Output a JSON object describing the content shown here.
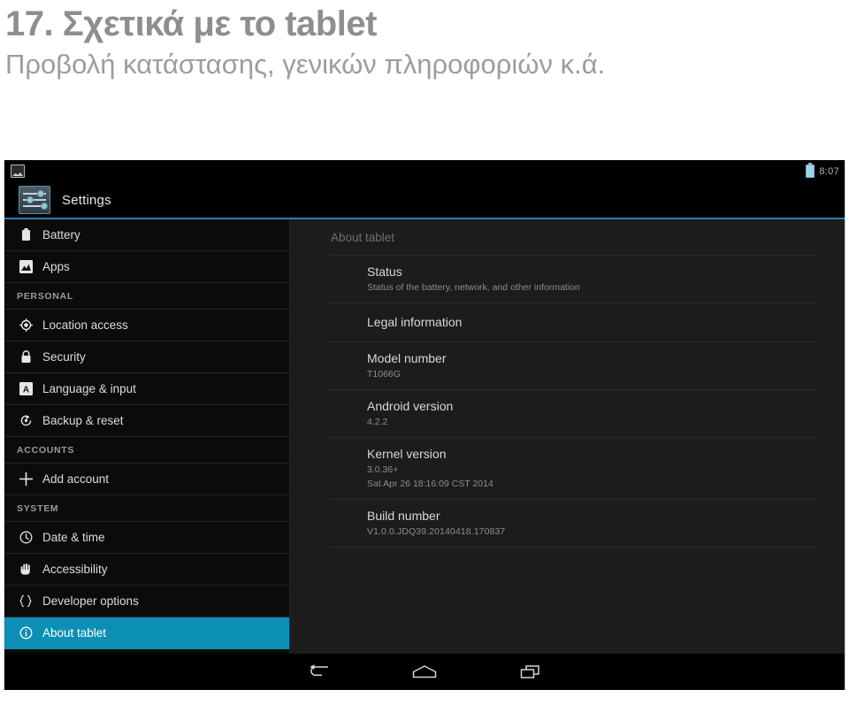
{
  "slide": {
    "title": "17. Σχετικά με το tablet",
    "subtitle": "Προβολή κατάστασης, γενικών πληροφοριών κ.ά."
  },
  "tablet": {
    "statusbar": {
      "notification_icon": "image-notification-icon",
      "battery_icon": "battery-icon",
      "time": "8:07"
    },
    "actionbar": {
      "app_icon": "settings-sliders-icon",
      "title": "Settings",
      "accent_color": "#2b7faa"
    },
    "sidebar": {
      "selected_color": "#0c8fb5",
      "items": [
        {
          "label": "Battery",
          "icon": "battery-icon",
          "type": "item",
          "selected": false
        },
        {
          "label": "Apps",
          "icon": "apps-image-icon",
          "type": "item",
          "selected": false
        },
        {
          "label": "PERSONAL",
          "type": "section"
        },
        {
          "label": "Location access",
          "icon": "location-icon",
          "type": "item",
          "selected": false
        },
        {
          "label": "Security",
          "icon": "lock-icon",
          "type": "item",
          "selected": false
        },
        {
          "label": "Language & input",
          "icon": "language-a-icon",
          "type": "item",
          "selected": false
        },
        {
          "label": "Backup & reset",
          "icon": "backup-restore-icon",
          "type": "item",
          "selected": false
        },
        {
          "label": "ACCOUNTS",
          "type": "section"
        },
        {
          "label": "Add account",
          "icon": "plus-icon",
          "type": "item",
          "selected": false
        },
        {
          "label": "SYSTEM",
          "type": "section"
        },
        {
          "label": "Date & time",
          "icon": "clock-icon",
          "type": "item",
          "selected": false
        },
        {
          "label": "Accessibility",
          "icon": "hand-icon",
          "type": "item",
          "selected": false
        },
        {
          "label": "Developer options",
          "icon": "braces-icon",
          "type": "item",
          "selected": false
        },
        {
          "label": "About tablet",
          "icon": "info-icon",
          "type": "item",
          "selected": true
        }
      ]
    },
    "content": {
      "title": "About tablet",
      "prefs": [
        {
          "title": "Status",
          "sub": "Status of the battery, network, and other information"
        },
        {
          "title": "Legal information",
          "sub": ""
        },
        {
          "title": "Model number",
          "sub": "T1066G"
        },
        {
          "title": "Android version",
          "sub": "4.2.2"
        },
        {
          "title": "Kernel version",
          "sub": "3.0.36+",
          "sub2": "Sat Apr 26 18:16:09 CST 2014"
        },
        {
          "title": "Build number",
          "sub": "V1.0.0.JDQ39.20140418.170837"
        }
      ]
    },
    "navbar": {
      "back": "back-icon",
      "home": "home-icon",
      "recents": "recent-apps-icon"
    }
  }
}
